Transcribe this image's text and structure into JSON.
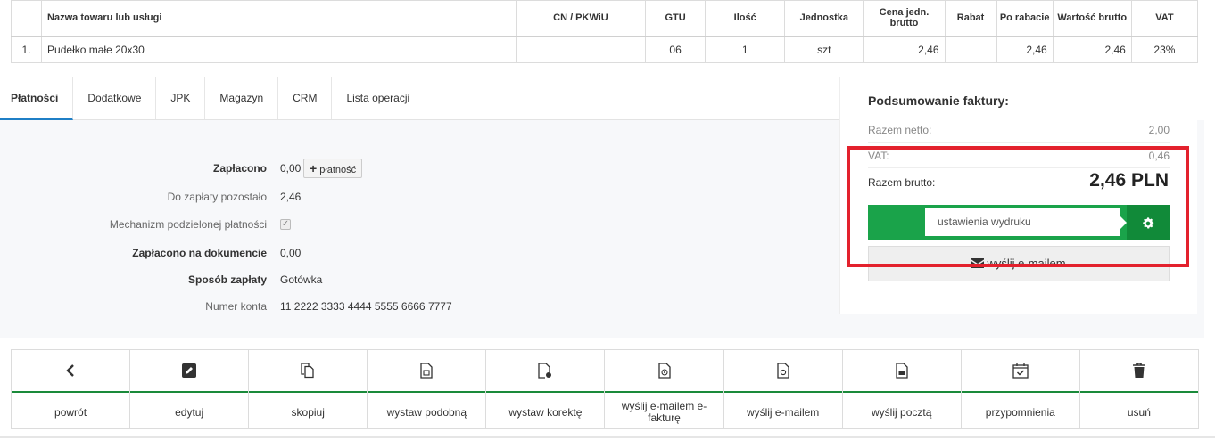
{
  "table": {
    "headers": [
      "",
      "Nazwa towaru lub usługi",
      "CN / PKWiU",
      "GTU",
      "Ilość",
      "Jednostka",
      "Cena jedn. brutto",
      "Rabat",
      "Po rabacie",
      "Wartość brutto",
      "VAT"
    ],
    "rows": [
      [
        "1.",
        "Pudełko małe 20x30",
        "",
        "06",
        "1",
        "szt",
        "2,46",
        "",
        "2,46",
        "2,46",
        "23%"
      ]
    ]
  },
  "tabs": [
    "Płatności",
    "Dodatkowe",
    "JPK",
    "Magazyn",
    "CRM",
    "Lista operacji"
  ],
  "payments": {
    "paid_label": "Zapłacono",
    "paid_value": "0,00",
    "add_payment_label": "płatność",
    "remaining_label": "Do zapłaty pozostało",
    "remaining_value": "2,46",
    "split_label": "Mechanizm podzielonej płatności",
    "paid_doc_label": "Zapłacono na dokumencie",
    "paid_doc_value": "0,00",
    "method_label": "Sposób zapłaty",
    "method_value": "Gotówka",
    "account_label": "Numer konta",
    "account_value": "11 2222 3333 4444 5555 6666 7777"
  },
  "summary": {
    "title": "Podsumowanie faktury:",
    "netto_label": "Razem netto:",
    "netto_value": "2,00",
    "vat_label": "VAT:",
    "vat_value": "0,46",
    "brutto_label": "Razem brutto:",
    "brutto_value": "2,46 PLN",
    "print_settings": "ustawienia wydruku",
    "mail_label": "wyślij e-mailem",
    "colors": {
      "green": "#1aa34a",
      "green_dark": "#118a39",
      "highlight": "#e3212d"
    }
  },
  "actions": [
    {
      "label": "powrót",
      "icon": "chevron-left-icon"
    },
    {
      "label": "edytuj",
      "icon": "edit-icon"
    },
    {
      "label": "skopiuj",
      "icon": "copy-icon"
    },
    {
      "label": "wystaw podobną",
      "icon": "document-similar-icon"
    },
    {
      "label": "wystaw korektę",
      "icon": "document-correction-icon"
    },
    {
      "label": "wyślij e-mailem e-fakturę",
      "icon": "document-email-icon"
    },
    {
      "label": "wyślij e-mailem",
      "icon": "document-at-icon"
    },
    {
      "label": "wyślij pocztą",
      "icon": "document-mail-icon"
    },
    {
      "label": "przypomnienia",
      "icon": "calendar-check-icon"
    },
    {
      "label": "usuń",
      "icon": "trash-icon"
    }
  ]
}
